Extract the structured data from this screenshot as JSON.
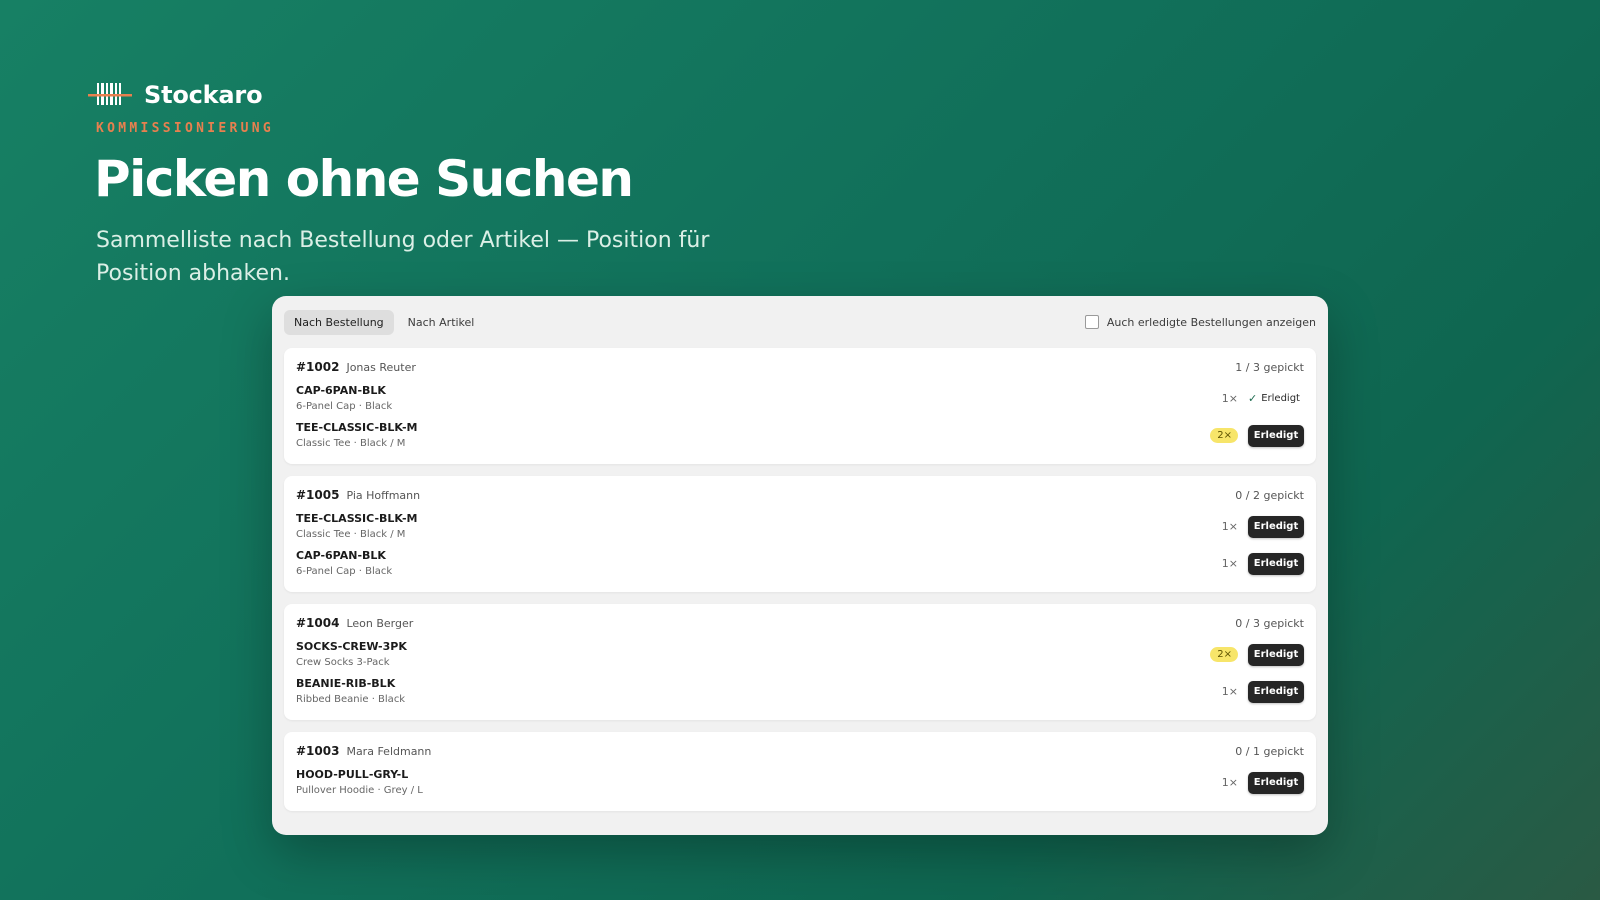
{
  "brand": {
    "name": "Stockaro",
    "eyebrow": "KOMMISSIONIERUNG",
    "logo_icon": "barcode-icon",
    "accent": "#e8804f"
  },
  "hero": {
    "title": "Picken ohne Suchen",
    "subtitle": "Sammelliste nach Bestellung oder Artikel — Position für Position abhaken."
  },
  "toolbar": {
    "tabs": [
      {
        "label": "Nach Bestellung",
        "active": true
      },
      {
        "label": "Nach Artikel",
        "active": false
      }
    ],
    "show_done_label": "Auch erledigte Bestellungen anzeigen"
  },
  "orders": [
    {
      "id": "#1002",
      "customer": "Jonas Reuter",
      "progress": "1 / 3 gepickt",
      "lines": [
        {
          "sku": "CAP-6PAN-BLK",
          "desc": "6-Panel Cap · Black",
          "qty": "1×",
          "done": true,
          "done_label": "Erledigt"
        },
        {
          "sku": "TEE-CLASSIC-BLK-M",
          "desc": "Classic Tee · Black / M",
          "qty": "2×",
          "highlight": true,
          "done": false,
          "button": "Erledigt"
        }
      ]
    },
    {
      "id": "#1005",
      "customer": "Pia Hoffmann",
      "progress": "0 / 2 gepickt",
      "lines": [
        {
          "sku": "TEE-CLASSIC-BLK-M",
          "desc": "Classic Tee · Black / M",
          "qty": "1×",
          "done": false,
          "button": "Erledigt"
        },
        {
          "sku": "CAP-6PAN-BLK",
          "desc": "6-Panel Cap · Black",
          "qty": "1×",
          "done": false,
          "button": "Erledigt"
        }
      ]
    },
    {
      "id": "#1004",
      "customer": "Leon Berger",
      "progress": "0 / 3 gepickt",
      "lines": [
        {
          "sku": "SOCKS-CREW-3PK",
          "desc": "Crew Socks 3-Pack",
          "qty": "2×",
          "highlight": true,
          "done": false,
          "button": "Erledigt"
        },
        {
          "sku": "BEANIE-RIB-BLK",
          "desc": "Ribbed Beanie · Black",
          "qty": "1×",
          "done": false,
          "button": "Erledigt"
        }
      ]
    },
    {
      "id": "#1003",
      "customer": "Mara Feldmann",
      "progress": "0 / 1 gepickt",
      "lines": [
        {
          "sku": "HOOD-PULL-GRY-L",
          "desc": "Pullover Hoodie · Grey / L",
          "qty": "1×",
          "done": false,
          "button": "Erledigt"
        }
      ]
    }
  ]
}
